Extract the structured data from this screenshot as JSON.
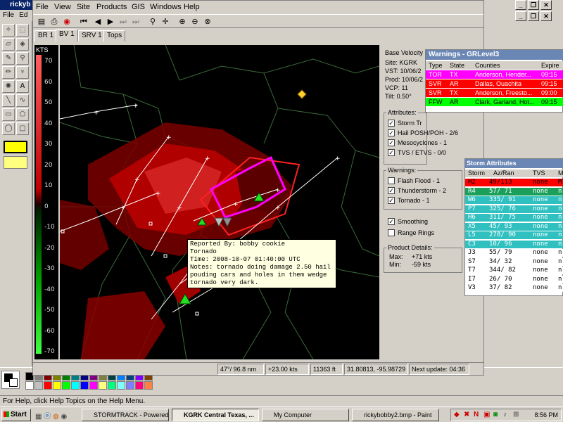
{
  "paint": {
    "title": "rickyb",
    "menu": [
      "File",
      "Ed"
    ],
    "status": "For Help, click Help Topics on the Help Menu.",
    "palette_colors": [
      "#000000",
      "#808080",
      "#800000",
      "#808000",
      "#008000",
      "#008080",
      "#000080",
      "#800080",
      "#808040",
      "#004040",
      "#0080ff",
      "#004080",
      "#8000ff",
      "#804000",
      "#ffffff",
      "#c0c0c0",
      "#ff0000",
      "#ffff00",
      "#00ff00",
      "#00ffff",
      "#0000ff",
      "#ff00ff",
      "#ffff80",
      "#00ff80",
      "#80ffff",
      "#8080ff",
      "#ff0080",
      "#ff8040"
    ]
  },
  "gr": {
    "menu": [
      "File",
      "View",
      "Site",
      "Products",
      "GIS",
      "Windows",
      "Help"
    ],
    "tabs": [
      "BR 1",
      "BV 1",
      "SRV 1",
      "Tops"
    ],
    "active_tab": "BV 1",
    "scale_unit": "KTS",
    "scale_labels": [
      "70",
      "60",
      "50",
      "40",
      "30",
      "20",
      "10",
      "0",
      "-10",
      "-20",
      "-30",
      "-40",
      "-50",
      "-60",
      "-70"
    ],
    "product": {
      "name": "Base Velocity",
      "site": "Site:  KGRK",
      "vst": "VST: 10/06/2",
      "prod": "Prod: 10/06/2",
      "vcp": "VCP:  11",
      "tilt": "Tilt:  0.50°"
    },
    "attributes": {
      "label": "Attributes:",
      "items": [
        "Storm Tr",
        "Hail POSH/POH - 2/6",
        "Mesocyclones - 1",
        "TVS / ETVS - 0/0"
      ]
    },
    "warnings_box": {
      "label": "Warnings:",
      "items": [
        "Flash Flood - 1",
        "Thunderstorm - 2",
        "Tornado - 1"
      ],
      "checked": [
        false,
        true,
        true
      ]
    },
    "options": {
      "smoothing": "Smoothing",
      "range_rings": "Range Rings"
    },
    "product_details": {
      "label": "Product Details:",
      "max_label": "Max:",
      "max_value": "+71 kts",
      "min_label": "Min:",
      "min_value": "-59 kts"
    },
    "status": {
      "azran": "47°/ 96.8 nm",
      "kts": "+23.00 kts",
      "height": "11363 ft",
      "latlon": "31.80813, -95.98729",
      "next": "Next update: 04:36"
    }
  },
  "tooltip": {
    "line1": "Reported By: bobby cookie",
    "line2": "Tornado",
    "line3": "Time: 2008-10-07 01:40:00 UTC",
    "line4": "Notes: tornado doing damage 2.50 hail",
    "line5": "pouding cars and holes in them wedge",
    "line6": "tornado very dark."
  },
  "warnings": {
    "title": "Warnings - GRLevel3",
    "headers": [
      "Type",
      "State",
      "Counties",
      "Expire"
    ],
    "rows": [
      {
        "type": "TOR",
        "state": "TX",
        "counties": "Anderson, Hender...",
        "expire": "09:15",
        "color": "#ff00ff"
      },
      {
        "type": "SVR",
        "state": "AR",
        "counties": "Dallas, Ouachita",
        "expire": "09:15",
        "color": "#ff0000"
      },
      {
        "type": "SVR",
        "state": "TX",
        "counties": "Anderson, Freesto...",
        "expire": "09:00",
        "color": "#ff0000"
      },
      {
        "type": "FFW",
        "state": "AR",
        "counties": "Clark, Garland, Hot...",
        "expire": "09:15",
        "color": "#00ff00"
      }
    ]
  },
  "storm": {
    "title": "Storm Attributes",
    "headers": [
      "Storm",
      "Az/Ran",
      "TVS",
      "M"
    ],
    "rows": [
      {
        "id": "H2",
        "az": "49/113",
        "tvs": "none",
        "m": "M",
        "bg": "#ff0000",
        "fg": "#000"
      },
      {
        "id": "R4",
        "az": "57/ 71",
        "tvs": "none",
        "m": "n",
        "bg": "#1aa05a",
        "fg": "#fff"
      },
      {
        "id": "W6",
        "az": "335/ 91",
        "tvs": "none",
        "m": "n",
        "bg": "#30c0c0",
        "fg": "#fff"
      },
      {
        "id": "P7",
        "az": "325/ 76",
        "tvs": "none",
        "m": "n",
        "bg": "#30c0c0",
        "fg": "#fff"
      },
      {
        "id": "H6",
        "az": "311/ 75",
        "tvs": "none",
        "m": "n",
        "bg": "#30c0c0",
        "fg": "#fff"
      },
      {
        "id": "X5",
        "az": "45/ 93",
        "tvs": "none",
        "m": "n",
        "bg": "#30c0c0",
        "fg": "#fff"
      },
      {
        "id": "L5",
        "az": "278/ 90",
        "tvs": "none",
        "m": "n",
        "bg": "#30c0c0",
        "fg": "#fff"
      },
      {
        "id": "C3",
        "az": "10/ 96",
        "tvs": "none",
        "m": "n",
        "bg": "#30c0c0",
        "fg": "#fff"
      },
      {
        "id": "J3",
        "az": "55/ 79",
        "tvs": "none",
        "m": "n",
        "bg": "#ffffff",
        "fg": "#000"
      },
      {
        "id": "S7",
        "az": "34/ 32",
        "tvs": "none",
        "m": "n",
        "bg": "#ffffff",
        "fg": "#000"
      },
      {
        "id": "T7",
        "az": "344/ 82",
        "tvs": "none",
        "m": "n",
        "bg": "#ffffff",
        "fg": "#000"
      },
      {
        "id": "I7",
        "az": "26/ 70",
        "tvs": "none",
        "m": "n",
        "bg": "#ffffff",
        "fg": "#000"
      },
      {
        "id": "V3",
        "az": "37/ 82",
        "tvs": "none",
        "m": "n",
        "bg": "#ffffff",
        "fg": "#000"
      }
    ]
  },
  "taskbar": {
    "start": "Start",
    "tasks": [
      "STORMTRACK - Powered...",
      "KGRK Central Texas, ...",
      "My Computer",
      "rickybobby2.bmp - Paint"
    ],
    "active_task": 1,
    "clock": "8:56 PM"
  }
}
